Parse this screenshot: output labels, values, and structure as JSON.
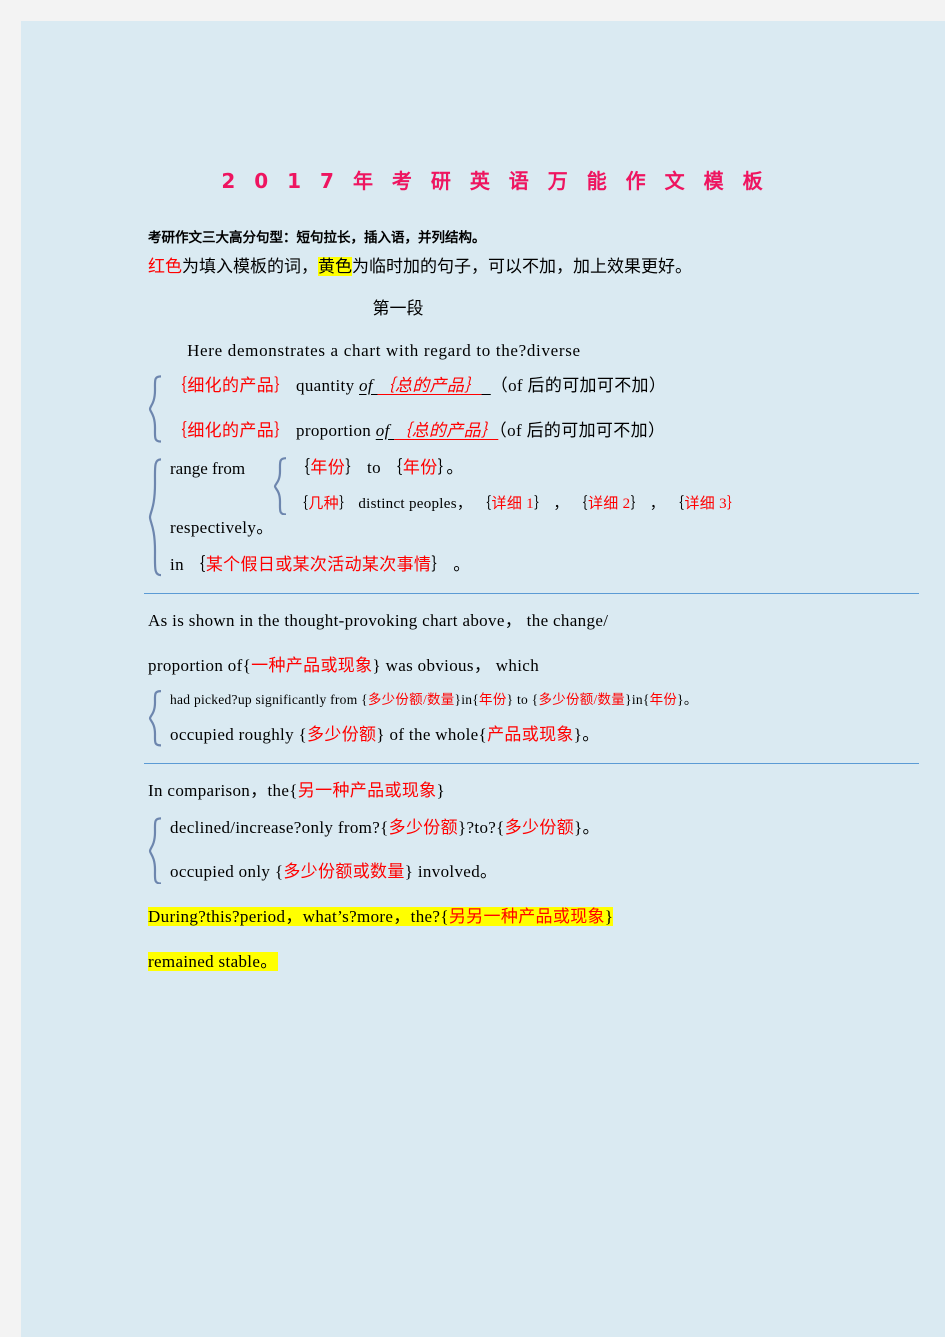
{
  "document": {
    "title": "2 0 1 7 年 考 研 英 语 万 能 作 文 模 板",
    "intro": {
      "line1": "考研作文三大高分句型：短句拉长，插入语，并列结构。",
      "line2_red": "红色",
      "line2_mid": "为填入模板的词，",
      "line2_yellow": "黄色",
      "line2_end": "为临时加的句子，可以不加，加上效果更好。"
    },
    "section1": {
      "label": "第一段",
      "lead": "Here  demonstrates  a  chart  with  regard  to  the?diverse",
      "option1": {
        "ph_begin": "｛细化的产品｝",
        "word": " quantity ",
        "underline_black": "of ",
        "underline_red": "｛总的产品｝",
        "note": "（of 后的可加可不加）"
      },
      "option2": {
        "ph_begin": "｛细化的产品｝",
        "word": " proportion ",
        "underline_black": "of ",
        "underline_red": "｛总的产品｝",
        "note": "（of 后的可加可不加）"
      },
      "range_label": "range  from",
      "range_a_pre": "｛",
      "range_a_red1": "年份",
      "range_a_mid": "｝ to ｛",
      "range_a_red2": "年份",
      "range_a_end": "｝。",
      "range_b_open": "｛",
      "range_b_red": "几种",
      "range_b_mid": "｝ distinct  peoples，  ｛",
      "range_b_d1": "详细 1",
      "range_b_sep1": "｝ ， ｛",
      "range_b_d2": "详细 2",
      "range_b_sep2": "｝ ， ｛",
      "range_b_d3": "详细 3",
      "range_b_close": "｝",
      "respectively": "respectively。",
      "in_line_pre": "in ｛",
      "in_line_red": "某个假日或某次活动某次事情",
      "in_line_end": "｝ 。"
    },
    "section2": {
      "line1": "As  is  shown  in  the  thought-provoking  chart  above，  the  change/",
      "line2_pre": "proportion  of{",
      "line2_red": "一种产品或现象",
      "line2_end": "}  was  obvious，  which",
      "opt1_a": "had  picked?up  significantly  from  {",
      "opt1_r1": "多少份额/数量",
      "opt1_b": "}in{",
      "opt1_r2": "年份",
      "opt1_c": "}  to  {",
      "opt1_r3": "多少份额/数量",
      "opt1_d": "}in{",
      "opt1_r4": "年份",
      "opt1_e": "}。",
      "opt2_a": "occupied  roughly  {",
      "opt2_r1": "多少份额",
      "opt2_b": "}  of  the  whole{",
      "opt2_r2": "产品或现象",
      "opt2_c": "}。"
    },
    "section3": {
      "line1_pre": "In  comparison，the{",
      "line1_red": "另一种产品或现象",
      "line1_end": "}",
      "opt1_a": "declined/increase?only  from?{",
      "opt1_r1": "多少份额",
      "opt1_b": "}?to?{",
      "opt1_r2": "多少份额",
      "opt1_c": "}。",
      "opt2_a": "occupied  only  {",
      "opt2_r1": "多少份额或数量",
      "opt2_b": "}  involved。",
      "hl_line1_a": "During?this?period，what’s?more，the?{",
      "hl_line1_red": "另另一种产品或现象",
      "hl_line1_b": "}",
      "hl_line2": "remained  stable。"
    },
    "colors": {
      "page_bg": "#daeaf2",
      "outer_bg": "#f3f3f3",
      "title": "#ee1560",
      "placeholder_red": "#ff0000",
      "highlight": "#ffff00",
      "brace": "#6d86ae",
      "divider": "#5b9bd5"
    }
  }
}
